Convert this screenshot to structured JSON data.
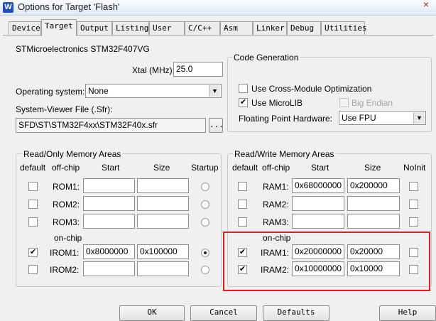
{
  "window": {
    "title": "Options for Target 'Flash'",
    "app_icon": "W",
    "close_glyph": "×"
  },
  "tabs": [
    "Device",
    "Target",
    "Output",
    "Listing",
    "User",
    "C/C++",
    "Asm",
    "Linker",
    "Debug",
    "Utilities"
  ],
  "device": {
    "name": "STMicroelectronics STM32F407VG",
    "xtal_label": "Xtal (MHz):",
    "xtal_value": "25.0",
    "os_label": "Operating system:",
    "os_value": "None",
    "svf_label": "System-Viewer File (.Sfr):",
    "svf_value": "SFD\\ST\\STM32F4xx\\STM32F40x.sfr",
    "browse_label": "..."
  },
  "code_gen": {
    "title": "Code Generation",
    "cross_module_label": "Use Cross-Module Optimization",
    "cross_module_checked": false,
    "microlib_label": "Use MicroLIB",
    "microlib_checked": true,
    "big_endian_label": "Big Endian",
    "big_endian_checked": false,
    "fpu_label": "Floating Point Hardware:",
    "fpu_value": "Use FPU"
  },
  "rom": {
    "title": "Read/Only Memory Areas",
    "headers": {
      "default": "default",
      "offchip": "off-chip",
      "start": "Start",
      "size": "Size",
      "startup": "Startup"
    },
    "onchip_label": "on-chip",
    "rows": [
      {
        "label": "ROM1:",
        "start": "",
        "size": "",
        "default": false,
        "startup": false
      },
      {
        "label": "ROM2:",
        "start": "",
        "size": "",
        "default": false,
        "startup": false
      },
      {
        "label": "ROM3:",
        "start": "",
        "size": "",
        "default": false,
        "startup": false
      },
      {
        "label": "IROM1:",
        "start": "0x8000000",
        "size": "0x100000",
        "default": true,
        "startup": true
      },
      {
        "label": "IROM2:",
        "start": "",
        "size": "",
        "default": false,
        "startup": false
      }
    ]
  },
  "ram": {
    "title": "Read/Write Memory Areas",
    "headers": {
      "default": "default",
      "offchip": "off-chip",
      "start": "Start",
      "size": "Size",
      "noinit": "NoInit"
    },
    "onchip_label": "on-chip",
    "rows": [
      {
        "label": "RAM1:",
        "start": "0x68000000",
        "size": "0x200000",
        "default": false,
        "noinit": false
      },
      {
        "label": "RAM2:",
        "start": "",
        "size": "",
        "default": false,
        "noinit": false
      },
      {
        "label": "RAM3:",
        "start": "",
        "size": "",
        "default": false,
        "noinit": false
      },
      {
        "label": "IRAM1:",
        "start": "0x20000000",
        "size": "0x20000",
        "default": true,
        "noinit": false
      },
      {
        "label": "IRAM2:",
        "start": "0x10000000",
        "size": "0x10000",
        "default": true,
        "noinit": false
      }
    ]
  },
  "buttons": {
    "ok": "OK",
    "cancel": "Cancel",
    "defaults": "Defaults",
    "help": "Help"
  },
  "colors": {
    "highlight": "#e02020",
    "accent": "#1f4fbf"
  }
}
